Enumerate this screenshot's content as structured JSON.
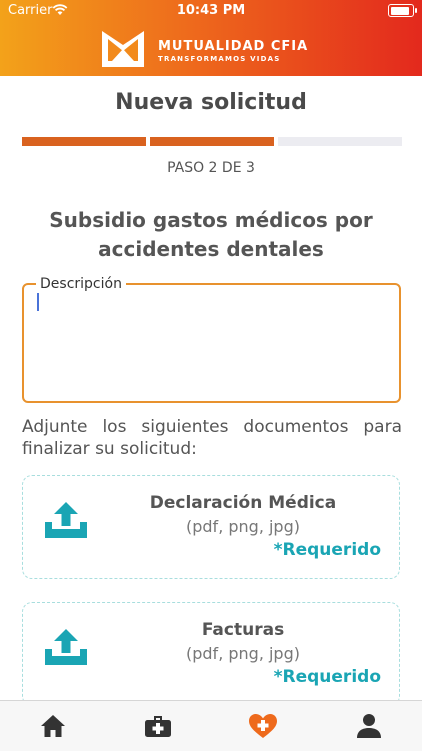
{
  "status_bar": {
    "carrier": "Carrier",
    "time": "10:43 PM"
  },
  "brand": {
    "name": "MUTUALIDAD CFIA",
    "tagline": "TRANSFORMAMOS VIDAS"
  },
  "page": {
    "title": "Nueva solicitud",
    "step_label": "PASO 2 DE 3"
  },
  "progress": {
    "current_step": 2,
    "total_steps": 3
  },
  "form": {
    "subtitle": "Subsidio gastos médicos por accidentes dentales",
    "description_label": "Descripción",
    "description_value": "",
    "instructions": "Adjunte los siguientes documentos para finalizar su solicitud:"
  },
  "uploads": [
    {
      "title": "Declaración Médica",
      "formats": "(pdf, png, jpg)",
      "required": "*Requerido"
    },
    {
      "title": "Facturas",
      "formats": "(pdf, png, jpg)",
      "required": "*Requerido"
    }
  ],
  "tabbar": {
    "items": [
      "home-icon",
      "medical-kit-icon",
      "heart-plus-icon",
      "user-icon"
    ]
  },
  "colors": {
    "progress_active": "#d9621f",
    "progress_inactive": "#ececf1",
    "accent": "#e8922e",
    "required": "#1aa5b4",
    "upload_icon": "#1aa5b4",
    "tab_active": "#ee6a1c",
    "tab_inactive": "#333333"
  }
}
